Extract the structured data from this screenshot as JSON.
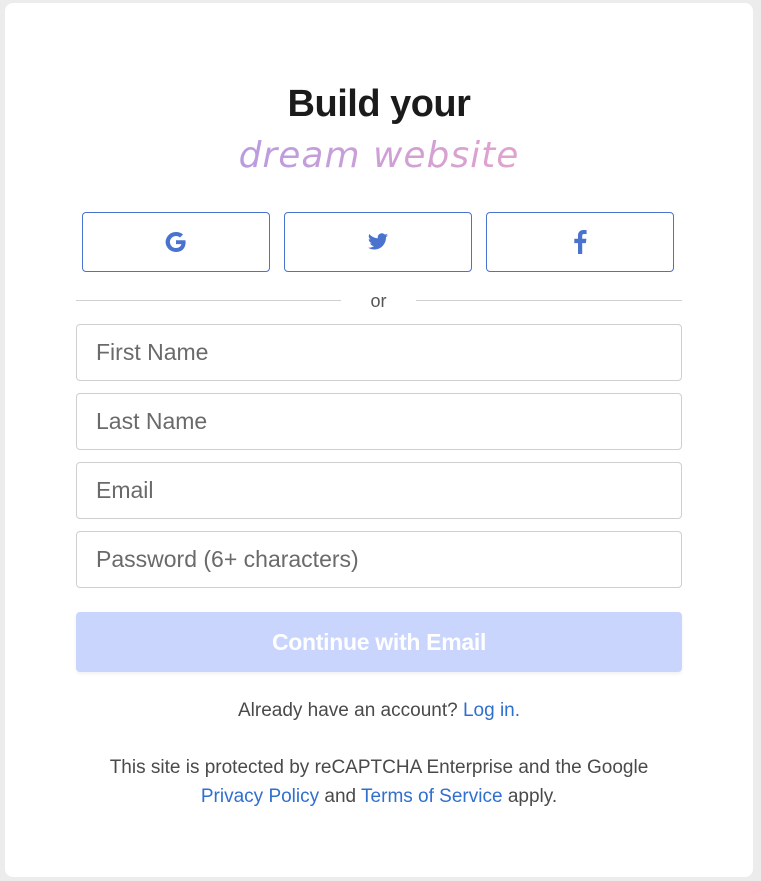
{
  "header": {
    "title": "Build your",
    "subtitle": "dream website"
  },
  "social": {
    "google_icon": "google-icon",
    "twitter_icon": "twitter-icon",
    "facebook_icon": "facebook-icon"
  },
  "divider": {
    "label": "or"
  },
  "form": {
    "first_name_placeholder": "First Name",
    "last_name_placeholder": "Last Name",
    "email_placeholder": "Email",
    "password_placeholder": "Password (6+ characters)",
    "submit_label": "Continue with Email"
  },
  "login": {
    "prompt": "Already have an account?",
    "link": "Log in."
  },
  "legal": {
    "text_before": "This site is protected by reCAPTCHA Enterprise and the Google",
    "privacy_link": "Privacy Policy",
    "and": "and",
    "terms_link": "Terms of Service",
    "text_after": "apply."
  },
  "colors": {
    "accent": "#4a72cf",
    "button_disabled": "#c9d5fd",
    "link": "#2f6fd0",
    "subtitle_purple": "#b79ce0",
    "subtitle_pink": "#e3a3cc"
  }
}
